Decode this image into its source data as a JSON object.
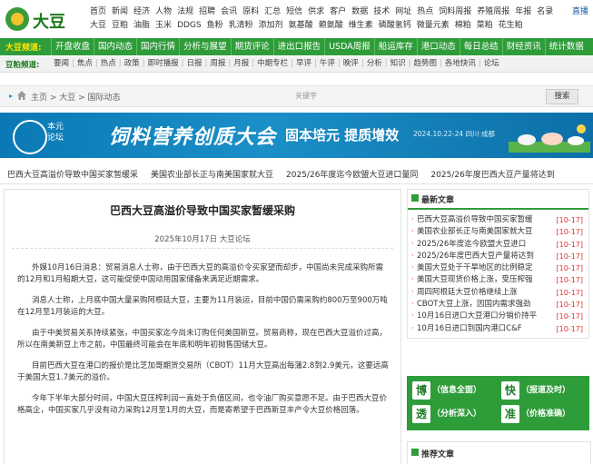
{
  "logo": {
    "text": "大豆"
  },
  "topnav": {
    "row1": [
      "首页",
      "新闻",
      "经济",
      "人物",
      "法规",
      "招聘",
      "会讯",
      "原料",
      "汇总",
      "短信",
      "供求",
      "客户",
      "数据",
      "技术",
      "网址",
      "热点",
      "饲料周报",
      "养殖周报",
      "年报",
      "名录"
    ],
    "row2": [
      "大豆",
      "豆粕",
      "油脂",
      "玉米",
      "DDGS",
      "鱼粉",
      "乳清粉",
      "添加剂",
      "氨基酸",
      "赖氨酸",
      "维生素",
      "磷酸氢钙",
      "微量元素",
      "棉粕",
      "菜粕",
      "花生粕"
    ],
    "extra": "直播"
  },
  "greenbar": {
    "label": "大豆频道:",
    "items": [
      "开盘收盘",
      "国内动态",
      "国内行情",
      "分析与展望",
      "期货评论",
      "进出口报告",
      "USDA周报",
      "船运库存",
      "港口动态",
      "每日总结",
      "财经资讯",
      "统计数据"
    ]
  },
  "graybar": {
    "label": "豆粕频道:",
    "items": [
      "要闻",
      "焦点",
      "热点",
      "政策",
      "即时播报",
      "日报",
      "周报",
      "月报",
      "中期专栏",
      "早评",
      "午评",
      "晚评",
      "分析",
      "知识",
      "趋势图",
      "各地快讯",
      "论坛"
    ]
  },
  "breadcrumb": {
    "path": "主页 > 大豆 > 国际动态",
    "keyword": "关键字",
    "search_label": "搜索"
  },
  "banner": {
    "org1": "本元",
    "org2": "论坛",
    "title": "饲料营养创质大会",
    "slogan": "固本培元 提质增效",
    "date": "2024.10.22-24  四川·成都"
  },
  "ticker": [
    "巴西大豆高溢价导致中国买家暂缓采",
    "美国农业部长正与南美国家就大豆",
    "2025/26年度迄今欧盟大豆进口量同",
    "2025/26年度巴西大豆产量将达到"
  ],
  "article": {
    "title": "巴西大豆高溢价导致中国买家暂缓采购",
    "meta": "2025年10月17日 大豆论坛",
    "paragraphs": [
      "外媒10月16日消息：贸易消息人士称，由于巴西大豆的高溢价令买家望而却步，中国尚未完成采购所需的12月和1月船期大豆，这可能促使中国动用国家储备来满足近期需求。",
      "消息人士称，上月底中国大量采购阿根廷大豆，主要为11月装运，目前中国仍需采购约800万至900万吨在12月至1月装运的大豆。",
      "由于中美贸易关系持续紧张，中国买家迄今尚未订购任何美国新豆。贸易商称，现在巴西大豆溢价过高，所以在南美新豆上市之前，中国最终可能会在年底和明年初抛售国储大豆。",
      "目前巴西大豆在港口的报价是比芝加哥期货交易所（CBOT）11月大豆高出每蒲2.8到2.9美元，这要远高于美国大豆1.7美元的溢价。",
      "今年下半年大部分时间，中国大豆压榨利润一直处于负值区间，也令油厂购买意愿不足。由于巴西大豆价格高企，中国买家几乎没有动力采购12月至1月的大豆，而是寄希望于巴西新豆丰产令大豆价格回落。"
    ]
  },
  "sidebar": {
    "latest_title": "最新文章",
    "latest": [
      {
        "title": "巴西大豆高溢价导致中国买家暂缓",
        "date": "[10-17]"
      },
      {
        "title": "美国农业部长正与南美国家就大豆",
        "date": "[10-17]"
      },
      {
        "title": "2025/26年度迄今欧盟大豆进口",
        "date": "[10-17]"
      },
      {
        "title": "2025/26年度巴西大豆产量将达到",
        "date": "[10-17]"
      },
      {
        "title": "美国大豆处于干旱地区的比例稳定",
        "date": "[10-17]"
      },
      {
        "title": "美国大豆现货价格上涨，受压榨强",
        "date": "[10-17]"
      },
      {
        "title": "周四阿根廷大豆价格继续上涨",
        "date": "[10-17]"
      },
      {
        "title": "CBOT大豆上涨，因国内需求强劲",
        "date": "[10-17]"
      },
      {
        "title": "10月16日进口大豆港口分销价持平",
        "date": "[10-17]"
      },
      {
        "title": "10月16日进口到国内港口C&F",
        "date": "[10-17]"
      }
    ],
    "ad": [
      {
        "char": "博",
        "text": "（信息全面）"
      },
      {
        "char": "快",
        "text": "（报道及时）"
      },
      {
        "char": "透",
        "text": "（分析深入）"
      },
      {
        "char": "准",
        "text": "（价格准确）"
      }
    ],
    "recommend_title": "推荐文章"
  }
}
